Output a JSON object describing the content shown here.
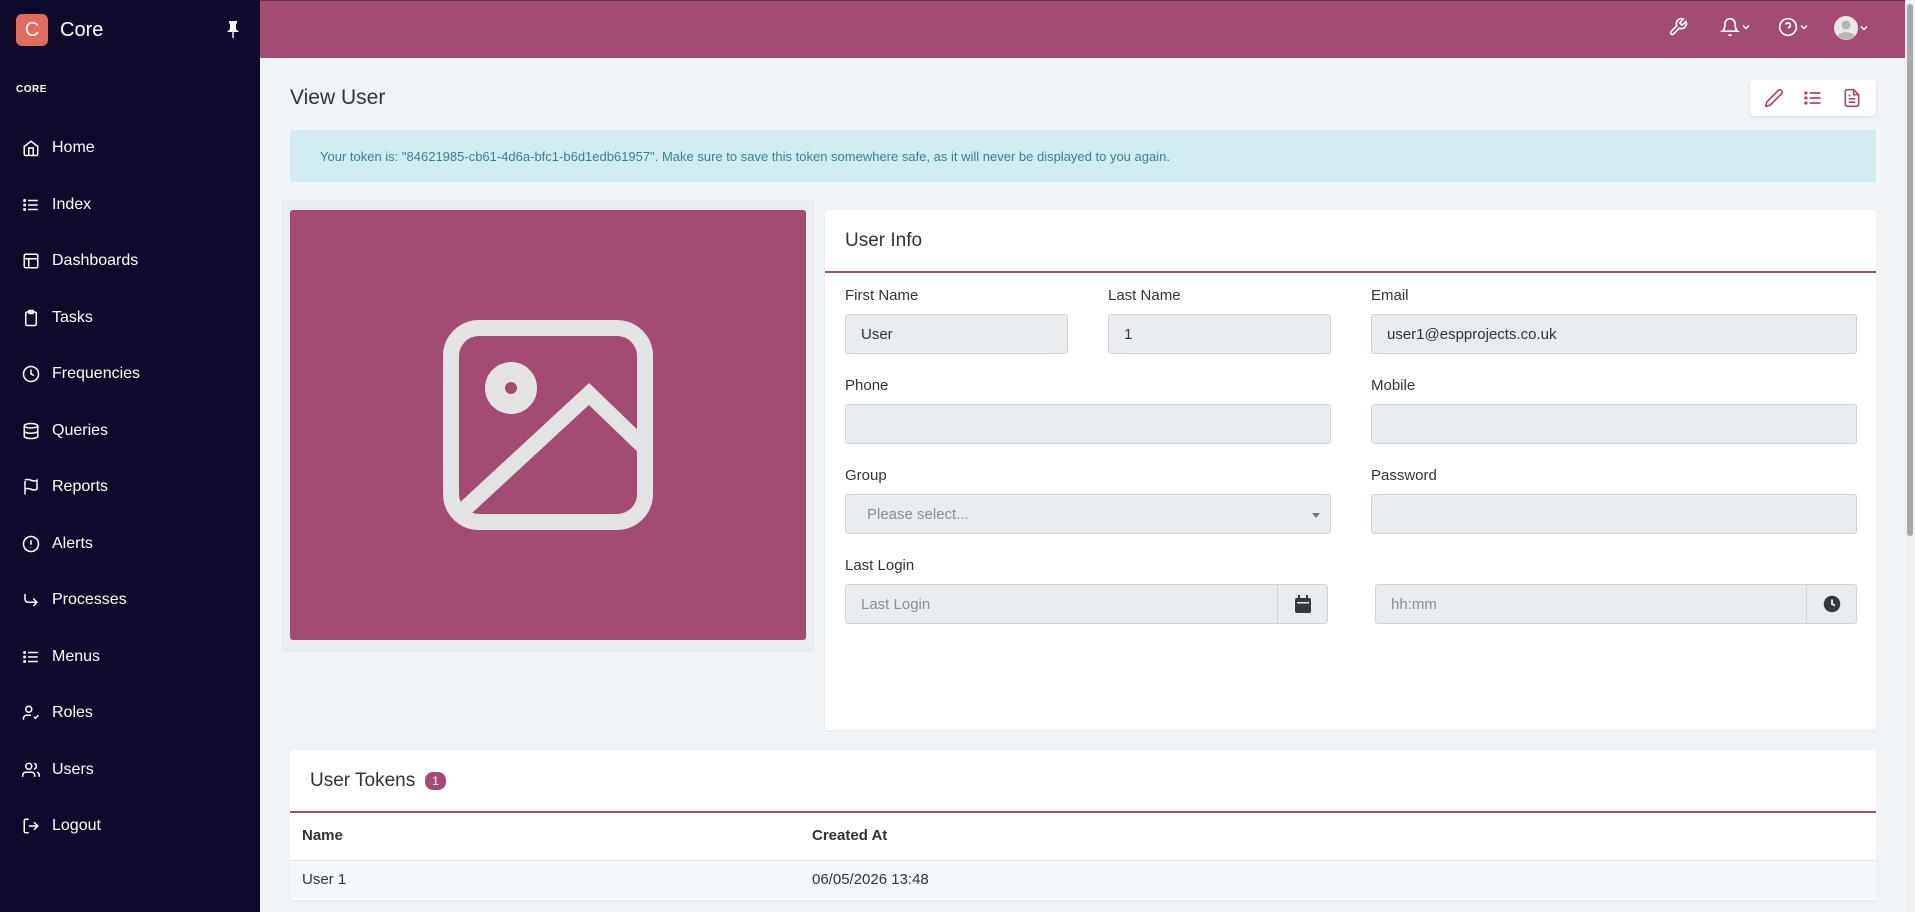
{
  "app": {
    "logo_letter": "C",
    "name": "Core"
  },
  "sidebar": {
    "section": "CORE",
    "items": [
      {
        "label": "Home",
        "icon": "home-icon"
      },
      {
        "label": "Index",
        "icon": "list-icon"
      },
      {
        "label": "Dashboards",
        "icon": "dashboard-icon"
      },
      {
        "label": "Tasks",
        "icon": "clipboard-icon"
      },
      {
        "label": "Frequencies",
        "icon": "clock-icon"
      },
      {
        "label": "Queries",
        "icon": "database-icon"
      },
      {
        "label": "Reports",
        "icon": "flag-icon"
      },
      {
        "label": "Alerts",
        "icon": "alert-circle-icon"
      },
      {
        "label": "Processes",
        "icon": "corner-down-right-icon"
      },
      {
        "label": "Menus",
        "icon": "list-icon"
      },
      {
        "label": "Roles",
        "icon": "user-check-icon"
      },
      {
        "label": "Users",
        "icon": "users-icon"
      },
      {
        "label": "Logout",
        "icon": "logout-icon"
      }
    ]
  },
  "page": {
    "title": "View User"
  },
  "alert": {
    "message": "Your token is: \"84621985-cb61-4d6a-bfc1-b6d1edb61957\". Make sure to save this token somewhere safe, as it will never be displayed to you again."
  },
  "user_info": {
    "title": "User Info",
    "first_name_label": "First Name",
    "first_name": "User",
    "last_name_label": "Last Name",
    "last_name": "1",
    "email_label": "Email",
    "email": "user1@espprojects.co.uk",
    "phone_label": "Phone",
    "phone": "",
    "mobile_label": "Mobile",
    "mobile": "",
    "group_label": "Group",
    "group_placeholder": "Please select...",
    "password_label": "Password",
    "password": "",
    "last_login_label": "Last Login",
    "last_login_placeholder": "Last Login",
    "time_placeholder": "hh:mm"
  },
  "tokens": {
    "title": "User Tokens",
    "count": "1",
    "columns": [
      "Name",
      "Created At"
    ],
    "rows": [
      {
        "name": "User 1",
        "created_at": "06/05/2026 13:48"
      }
    ]
  },
  "colors": {
    "brand": "#a24b73",
    "sidebar": "#0e0a2c",
    "logo": "#e36b5b",
    "alert_bg": "#d1ecf1"
  }
}
